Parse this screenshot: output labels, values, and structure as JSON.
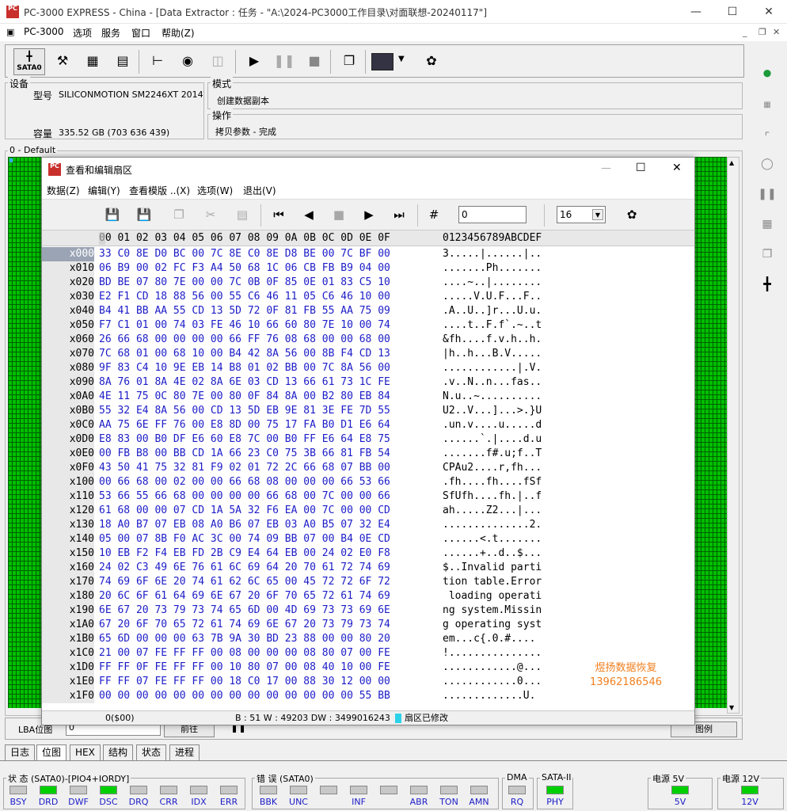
{
  "window": {
    "title": "PC-3000 EXPRESS - China - [Data Extractor : 任务 - \"A:\\2024-PC3000工作目录\\对面联想-20240117\"]",
    "logo_text": "PC"
  },
  "menu": {
    "app": "PC-3000",
    "items": [
      "选项",
      "服务",
      "窗口",
      "帮助(Z)"
    ]
  },
  "toolbar": {
    "sata_label": "SATA0"
  },
  "device": {
    "group_label": "设备",
    "model_label": "型号",
    "model_value": "SILICONMOTION SM2246XT 2014112",
    "capacity_label": "容量",
    "capacity_value": "335.52 GB (703 636 439)"
  },
  "mode": {
    "group_label": "模式",
    "value": "创建数据副本"
  },
  "operation": {
    "group_label": "操作",
    "value": "拷贝参数 - 完成"
  },
  "bitmap": {
    "label": "0 - Default"
  },
  "dialog": {
    "title": "查看和编辑扇区",
    "menu": [
      "数据(Z)",
      "编辑(Y)",
      "查看模版 ..(X)",
      "选项(W)",
      "退出(V)"
    ],
    "sector_input": "0",
    "cols_value": "16",
    "header_hex": "00 01 02 03 04 05 06 07 08 09 0A 0B 0C 0D 0E 0F",
    "header_ascii": "0123456789ABCDEF",
    "rows": [
      {
        "off": "x000",
        "hex": "33 C0 8E D0 BC 00 7C 8E C0 8E D8 BE 00 7C BF 00",
        "asc": "3.....|......|.."
      },
      {
        "off": "x010",
        "hex": "06 B9 00 02 FC F3 A4 50 68 1C 06 CB FB B9 04 00",
        "asc": ".......Ph......."
      },
      {
        "off": "x020",
        "hex": "BD BE 07 80 7E 00 00 7C 0B 0F 85 0E 01 83 C5 10",
        "asc": "....~..|........"
      },
      {
        "off": "x030",
        "hex": "E2 F1 CD 18 88 56 00 55 C6 46 11 05 C6 46 10 00",
        "asc": ".....V.U.F...F.."
      },
      {
        "off": "x040",
        "hex": "B4 41 BB AA 55 CD 13 5D 72 0F 81 FB 55 AA 75 09",
        "asc": ".A..U..]r...U.u."
      },
      {
        "off": "x050",
        "hex": "F7 C1 01 00 74 03 FE 46 10 66 60 80 7E 10 00 74",
        "asc": "....t..F.f`.~..t"
      },
      {
        "off": "x060",
        "hex": "26 66 68 00 00 00 00 66 FF 76 08 68 00 00 68 00",
        "asc": "&fh....f.v.h..h."
      },
      {
        "off": "x070",
        "hex": "7C 68 01 00 68 10 00 B4 42 8A 56 00 8B F4 CD 13",
        "asc": "|h..h...B.V....."
      },
      {
        "off": "x080",
        "hex": "9F 83 C4 10 9E EB 14 B8 01 02 BB 00 7C 8A 56 00",
        "asc": "............|.V."
      },
      {
        "off": "x090",
        "hex": "8A 76 01 8A 4E 02 8A 6E 03 CD 13 66 61 73 1C FE",
        "asc": ".v..N..n...fas.."
      },
      {
        "off": "x0A0",
        "hex": "4E 11 75 0C 80 7E 00 80 0F 84 8A 00 B2 80 EB 84",
        "asc": "N.u..~.........."
      },
      {
        "off": "x0B0",
        "hex": "55 32 E4 8A 56 00 CD 13 5D EB 9E 81 3E FE 7D 55",
        "asc": "U2..V...]...>.}U"
      },
      {
        "off": "x0C0",
        "hex": "AA 75 6E FF 76 00 E8 8D 00 75 17 FA B0 D1 E6 64",
        "asc": ".un.v....u.....d"
      },
      {
        "off": "x0D0",
        "hex": "E8 83 00 B0 DF E6 60 E8 7C 00 B0 FF E6 64 E8 75",
        "asc": "......`.|....d.u"
      },
      {
        "off": "x0E0",
        "hex": "00 FB B8 00 BB CD 1A 66 23 C0 75 3B 66 81 FB 54",
        "asc": ".......f#.u;f..T"
      },
      {
        "off": "x0F0",
        "hex": "43 50 41 75 32 81 F9 02 01 72 2C 66 68 07 BB 00",
        "asc": "CPAu2....r,fh..."
      },
      {
        "off": "x100",
        "hex": "00 66 68 00 02 00 00 66 68 08 00 00 00 66 53 66",
        "asc": ".fh....fh....fSf"
      },
      {
        "off": "x110",
        "hex": "53 66 55 66 68 00 00 00 00 66 68 00 7C 00 00 66",
        "asc": "SfUfh....fh.|..f"
      },
      {
        "off": "x120",
        "hex": "61 68 00 00 07 CD 1A 5A 32 F6 EA 00 7C 00 00 CD",
        "asc": "ah.....Z2...|..."
      },
      {
        "off": "x130",
        "hex": "18 A0 B7 07 EB 08 A0 B6 07 EB 03 A0 B5 07 32 E4",
        "asc": "..............2."
      },
      {
        "off": "x140",
        "hex": "05 00 07 8B F0 AC 3C 00 74 09 BB 07 00 B4 0E CD",
        "asc": "......<.t......."
      },
      {
        "off": "x150",
        "hex": "10 EB F2 F4 EB FD 2B C9 E4 64 EB 00 24 02 E0 F8",
        "asc": "......+..d..$..."
      },
      {
        "off": "x160",
        "hex": "24 02 C3 49 6E 76 61 6C 69 64 20 70 61 72 74 69",
        "asc": "$..Invalid parti"
      },
      {
        "off": "x170",
        "hex": "74 69 6F 6E 20 74 61 62 6C 65 00 45 72 72 6F 72",
        "asc": "tion table.Error"
      },
      {
        "off": "x180",
        "hex": "20 6C 6F 61 64 69 6E 67 20 6F 70 65 72 61 74 69",
        "asc": " loading operati"
      },
      {
        "off": "x190",
        "hex": "6E 67 20 73 79 73 74 65 6D 00 4D 69 73 73 69 6E",
        "asc": "ng system.Missin"
      },
      {
        "off": "x1A0",
        "hex": "67 20 6F 70 65 72 61 74 69 6E 67 20 73 79 73 74",
        "asc": "g operating syst"
      },
      {
        "off": "x1B0",
        "hex": "65 6D 00 00 00 63 7B 9A 30 BD 23 88 00 00 80 20",
        "asc": "em...c{.0.#...."
      },
      {
        "off": "x1C0",
        "hex": "21 00 07 FE FF FF 00 08 00 00 00 08 80 07 00 FE",
        "asc": "!..............."
      },
      {
        "off": "x1D0",
        "hex": "FF FF 0F FE FF FF 00 10 80 07 00 08 40 10 00 FE",
        "asc": "............@..."
      },
      {
        "off": "x1E0",
        "hex": "FF FF 07 FE FF FF 00 18 C0 17 00 88 30 12 00 00",
        "asc": "............0..."
      },
      {
        "off": "x1F0",
        "hex": "00 00 00 00 00 00 00 00 00 00 00 00 00 00 55 BB",
        "asc": ".............U."
      }
    ],
    "watermark_line1": "煜扬数据恢复",
    "watermark_line2": "13962186546",
    "status_pos": "0($00)",
    "status_values": "B : 51 W : 49203 DW : 3499016243",
    "status_modified": "扇区已修改"
  },
  "lba": {
    "label": "LBA位图",
    "value": "0",
    "goto": "前往",
    "legend": "图例"
  },
  "tabs": [
    "日志",
    "位图",
    "HEX",
    "结构",
    "状态",
    "进程"
  ],
  "status": {
    "state_label": "状 态 (SATA0)-[PIO4+IORDY]",
    "state_leds": [
      {
        "name": "BSY",
        "on": false
      },
      {
        "name": "DRD",
        "on": true
      },
      {
        "name": "DWF",
        "on": false
      },
      {
        "name": "DSC",
        "on": true
      },
      {
        "name": "DRQ",
        "on": false
      },
      {
        "name": "CRR",
        "on": false
      },
      {
        "name": "IDX",
        "on": false
      },
      {
        "name": "ERR",
        "on": false
      }
    ],
    "error_label": "错 误 (SATA0)",
    "error_leds": [
      {
        "name": "BBK",
        "on": false
      },
      {
        "name": "UNC",
        "on": false
      },
      {
        "name": "",
        "on": false
      },
      {
        "name": "INF",
        "on": false
      },
      {
        "name": "",
        "on": false
      },
      {
        "name": "ABR",
        "on": false
      },
      {
        "name": "TON",
        "on": false
      },
      {
        "name": "AMN",
        "on": false
      }
    ],
    "dma_label": "DMA",
    "dma_led": "RQ",
    "sata_label": "SATA-II",
    "sata_led": "PHY",
    "p5_label": "电源 5V",
    "p5_led": "5V",
    "p12_label": "电源 12V",
    "p12_led": "12V"
  }
}
